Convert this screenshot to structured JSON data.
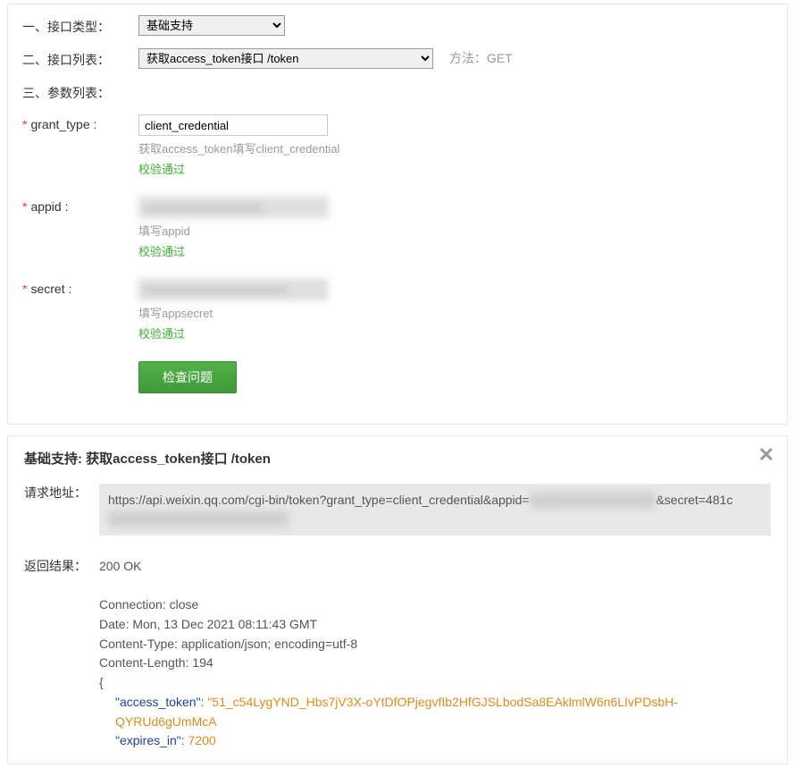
{
  "form": {
    "row1_label": "一、接口类型：",
    "row2_label": "二、接口列表：",
    "row3_label": "三、参数列表：",
    "interface_type_selected": "基础支持",
    "interface_list_selected": "获取access_token接口 /token",
    "method_prefix": "方法：",
    "method_value": "GET",
    "params": {
      "grant_type": {
        "label": "grant_type :",
        "value": "client_credential",
        "hint": "获取access_token填写client_credential",
        "validate": "校验通过"
      },
      "appid": {
        "label": "appid :",
        "value": "wx0000000000000000",
        "hint": "填写appid",
        "validate": "校验通过"
      },
      "secret": {
        "label": "secret :",
        "value": "0000000000000000000000",
        "hint": "填写appsecret",
        "validate": "校验通过"
      }
    },
    "submit_label": "检查问题"
  },
  "result": {
    "title": "基础支持: 获取access_token接口 /token",
    "request_url_label": "请求地址：",
    "request_url_pre": "https://api.weixin.qq.com/cgi-bin/token?grant_type=client_credential&appid=",
    "request_url_blur1": "wx0000000000000000",
    "request_url_mid": "&secret=481c",
    "request_url_blur2": "00000000000000000000000000",
    "response_label": "返回结果：",
    "status_line": "200 OK",
    "headers": {
      "connection": "Connection: close",
      "date": "Date: Mon, 13 Dec 2021 08:11:43 GMT",
      "content_type": "Content-Type: application/json; encoding=utf-8",
      "content_length": "Content-Length: 194"
    },
    "json_body": {
      "open_brace": "{",
      "access_token_key": "\"access_token\"",
      "access_token_val": "\"51_c54LygYND_Hbs7jV3X-oYtDfOPjegvfIb2HfGJSLbodSa8EAklmlW6n6LIvPDsbH-QYRUd6gUmMcA",
      "expires_in_key": "\"expires_in\"",
      "expires_in_val": "7200"
    }
  }
}
